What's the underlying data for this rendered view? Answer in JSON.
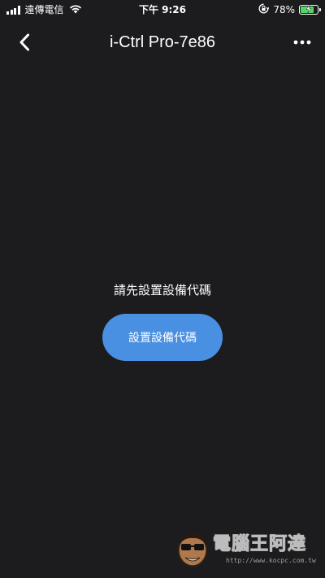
{
  "status_bar": {
    "carrier": "遠傳電信",
    "time": "下午 9:26",
    "battery_percent": "78%",
    "battery_level": 0.78,
    "icons": [
      "signal-icon",
      "wifi-icon",
      "rotation-lock-icon",
      "battery-icon",
      "charging-bolt-icon"
    ]
  },
  "nav": {
    "title": "i-Ctrl Pro-7e86",
    "back_icon": "chevron-left-icon",
    "more_icon": "more-horizontal-icon"
  },
  "main": {
    "prompt": "請先設置設備代碼",
    "setup_button_label": "設置設備代碼"
  },
  "watermark": {
    "text": "電腦王阿達",
    "url": "http://www.kocpc.com.tw"
  },
  "colors": {
    "background": "#1c1c1e",
    "accent": "#4a90e2",
    "battery_fill": "#4cd964",
    "text": "#ffffff"
  }
}
